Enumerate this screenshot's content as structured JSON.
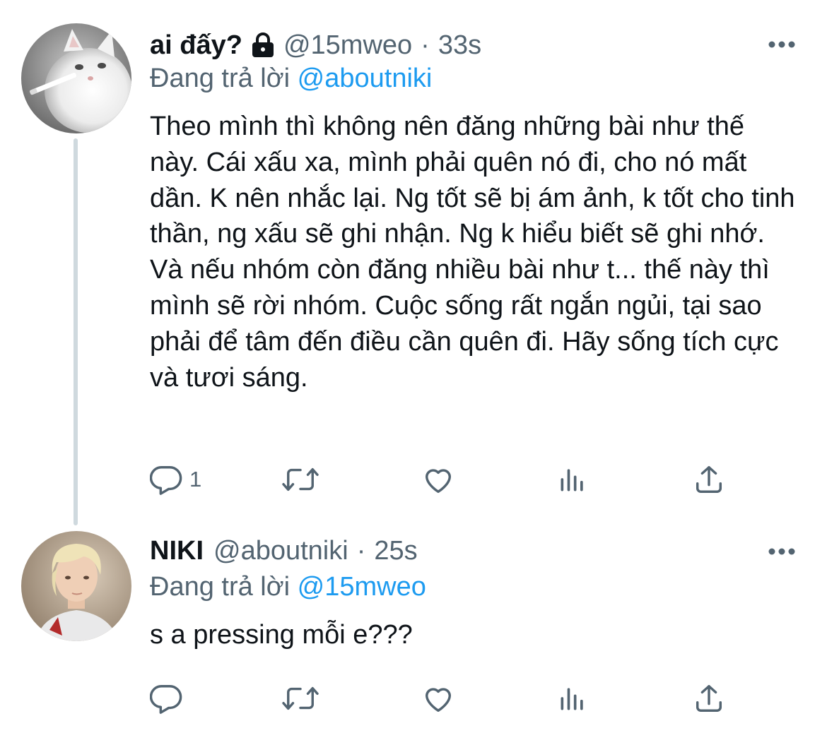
{
  "tweets": [
    {
      "display_name": "ai đấy?",
      "protected": true,
      "handle": "@15mweo",
      "separator": "·",
      "time": "33s",
      "reply_prefix": "Đang trả lời",
      "reply_to": "@aboutniki",
      "text": "Theo mình thì không nên đăng những bài như thế này. Cái xấu xa, mình phải quên nó đi, cho nó mất dần. K nên nhắc lại. Ng tốt sẽ bị ám ảnh, k tốt cho tinh thần, ng xấu sẽ ghi nhận. Ng k hiểu biết sẽ ghi nhớ. Và nếu nhóm còn đăng nhiều bài như t... thế này thì mình sẽ rời nhóm. Cuộc sống rất ngắn ngủi, tại sao phải để tâm đến điều cần quên đi. Hãy sống tích cực và tươi sáng.",
      "reply_count": "1",
      "avatar_icon": "cat-avatar"
    },
    {
      "display_name": "NIKI",
      "protected": false,
      "handle": "@aboutniki",
      "separator": "·",
      "time": "25s",
      "reply_prefix": "Đang trả lời",
      "reply_to": "@15mweo",
      "text": "s a pressing mỗi e???",
      "reply_count": "",
      "avatar_icon": "person-avatar"
    }
  ],
  "icons": {
    "reply": "reply-icon",
    "retweet": "retweet-icon",
    "like": "heart-icon",
    "analytics": "analytics-icon",
    "share": "share-icon",
    "more": "more-icon",
    "lock": "lock-icon"
  },
  "colors": {
    "text_primary": "#0f1419",
    "text_secondary": "#536471",
    "accent": "#1d9bf0",
    "thread_line": "#cfd9de"
  }
}
